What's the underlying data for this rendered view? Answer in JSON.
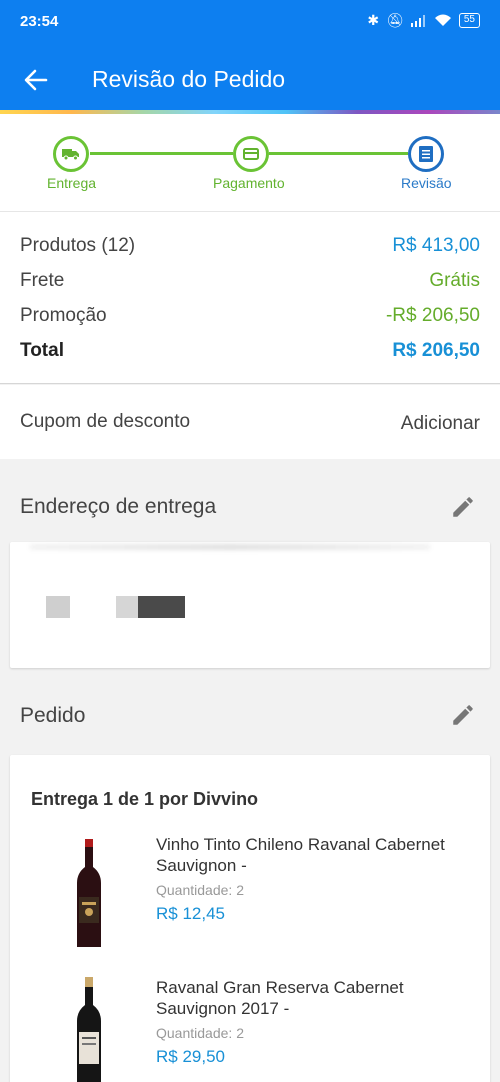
{
  "status_bar": {
    "time": "23:54",
    "battery": "55"
  },
  "header": {
    "title": "Revisão do Pedido"
  },
  "stepper": {
    "steps": [
      {
        "label": "Entrega"
      },
      {
        "label": "Pagamento"
      },
      {
        "label": "Revisão"
      }
    ]
  },
  "summary": {
    "products_label": "Produtos (12)",
    "products_value": "R$ 413,00",
    "shipping_label": "Frete",
    "shipping_value": "Grátis",
    "promo_label": "Promoção",
    "promo_value": "-R$ 206,50",
    "total_label": "Total",
    "total_value": "R$ 206,50"
  },
  "coupon": {
    "label": "Cupom de desconto",
    "action": "Adicionar"
  },
  "address": {
    "title": "Endereço de entrega"
  },
  "order": {
    "title": "Pedido",
    "delivery_title": "Entrega 1 de 1 por Divvino",
    "quantity_label": "Quantidade:",
    "items": [
      {
        "name": "Vinho Tinto Chileno Ravanal Cabernet Sauvignon -",
        "quantity": "2",
        "price": "R$ 12,45"
      },
      {
        "name": "Ravanal Gran Reserva Cabernet Sauvignon 2017 -",
        "quantity": "2",
        "price": "R$ 29,50"
      }
    ]
  },
  "colors": {
    "primary": "#0d7ff0",
    "step_done": "#6ac335",
    "step_current": "#1f6ec2",
    "price_blue": "#1890d6",
    "green": "#64ac2b"
  }
}
